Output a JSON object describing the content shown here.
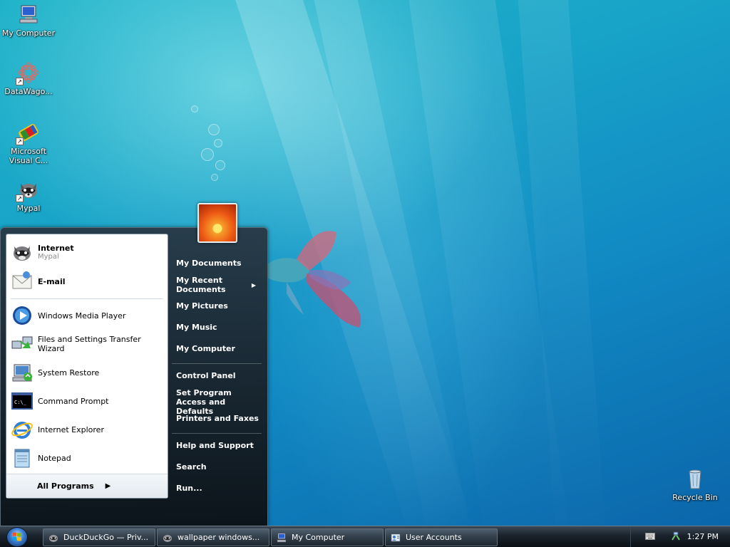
{
  "desktop": {
    "icons": [
      {
        "label": "My Computer",
        "icon": "my-computer-icon"
      },
      {
        "label": "DataWago...",
        "icon": "datawagon-icon"
      },
      {
        "label": "Microsoft Visual C...",
        "icon": "visual-c-icon"
      },
      {
        "label": "Mypal",
        "icon": "mypal-icon"
      },
      {
        "label": "Recycle Bin",
        "icon": "recycle-bin-icon"
      }
    ]
  },
  "start_menu": {
    "pinned": [
      {
        "label": "Internet",
        "sub": "Mypal",
        "icon": "mypal-icon"
      },
      {
        "label": "E-mail",
        "icon": "email-icon"
      }
    ],
    "recent": [
      {
        "label": "Windows Media Player",
        "icon": "media-player-icon"
      },
      {
        "label": "Files and Settings Transfer Wizard",
        "icon": "transfer-wizard-icon"
      },
      {
        "label": "System Restore",
        "icon": "system-restore-icon"
      },
      {
        "label": "Command Prompt",
        "icon": "command-prompt-icon"
      },
      {
        "label": "Internet Explorer",
        "icon": "internet-explorer-icon"
      },
      {
        "label": "Notepad",
        "icon": "notepad-icon"
      }
    ],
    "all_programs": "All Programs",
    "right": [
      {
        "label": "My Documents"
      },
      {
        "label": "My Recent Documents",
        "has_submenu": true
      },
      {
        "label": "My Pictures"
      },
      {
        "label": "My Music"
      },
      {
        "label": "My Computer"
      },
      {
        "label": "Control Panel"
      },
      {
        "label": "Set Program Access and Defaults"
      },
      {
        "label": "Printers and Faxes"
      },
      {
        "label": "Help and Support"
      },
      {
        "label": "Search"
      },
      {
        "label": "Run..."
      }
    ]
  },
  "taskbar": {
    "buttons": [
      {
        "label": "DuckDuckGo — Priv...",
        "icon": "mypal-icon"
      },
      {
        "label": "wallpaper windows...",
        "icon": "mypal-icon"
      },
      {
        "label": "My Computer",
        "icon": "my-computer-icon"
      },
      {
        "label": "User Accounts",
        "icon": "user-accounts-icon"
      }
    ],
    "clock": "1:27 PM"
  }
}
